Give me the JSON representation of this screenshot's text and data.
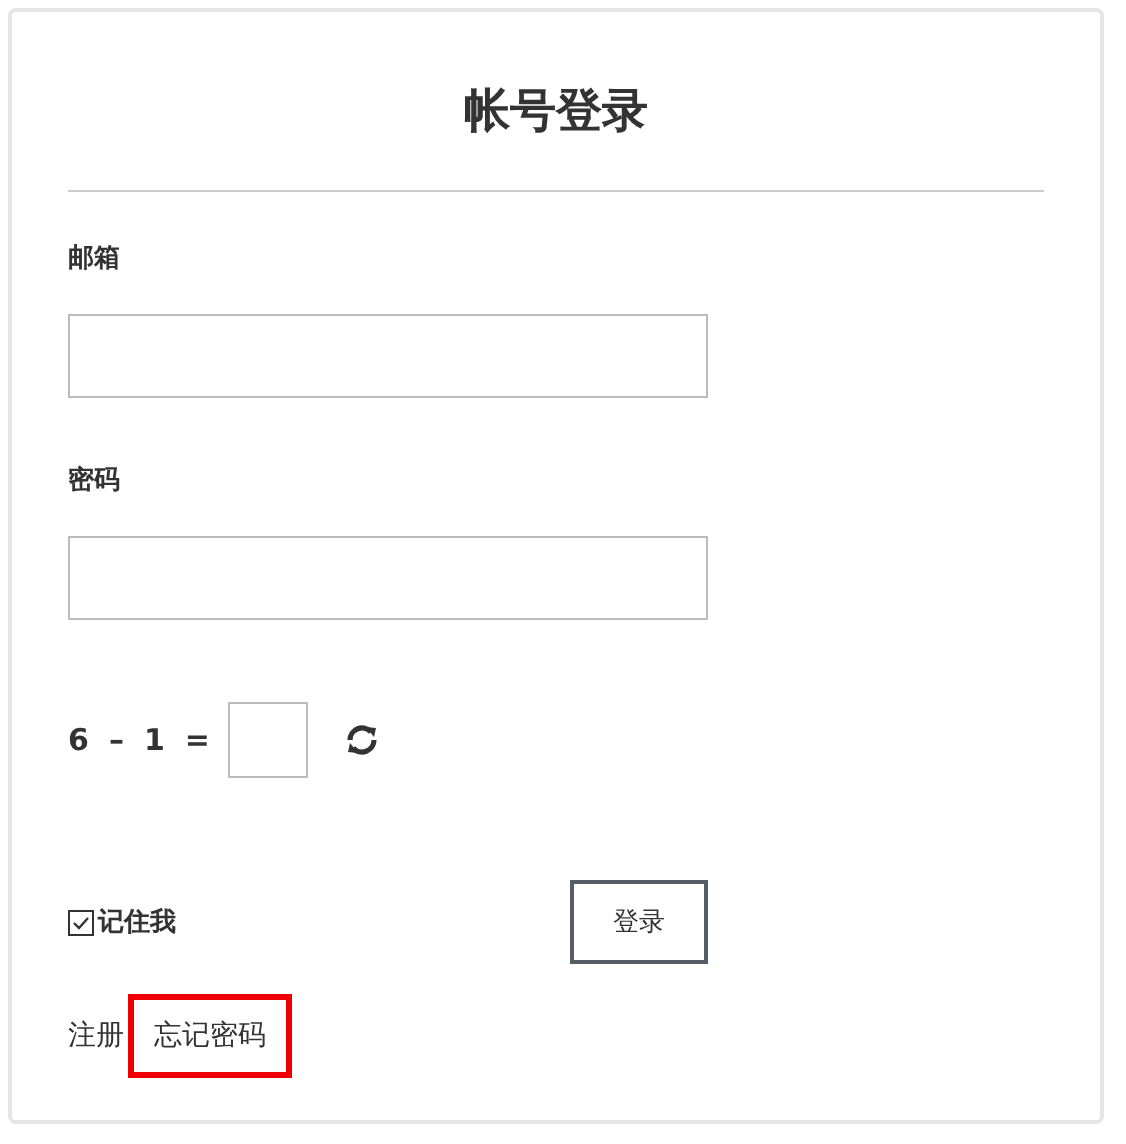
{
  "title": "帐号登录",
  "fields": [
    {
      "label": "邮箱"
    },
    {
      "label": "密码"
    }
  ],
  "captcha": {
    "tokens": [
      "6",
      "–",
      "1",
      "="
    ]
  },
  "remember": {
    "label": "记住我",
    "checked": true
  },
  "submit": "登录",
  "links": [
    {
      "label": "注册",
      "highlighted": false
    },
    {
      "label": "忘记密码",
      "highlighted": true
    }
  ]
}
